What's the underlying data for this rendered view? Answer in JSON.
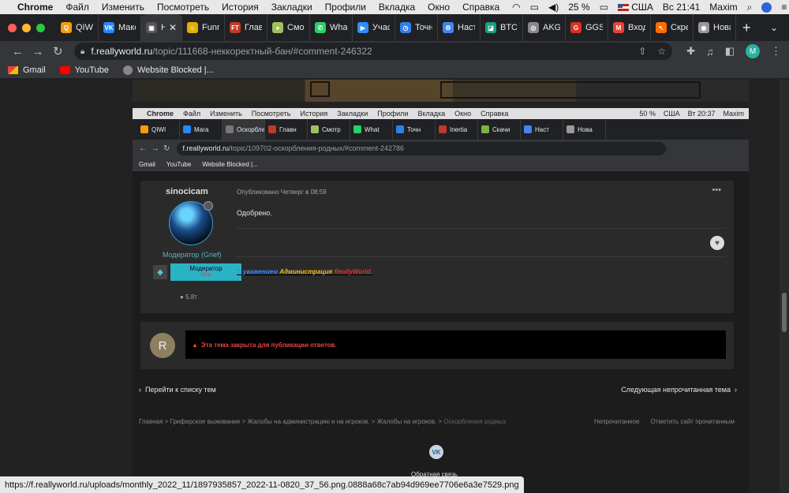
{
  "menubar": {
    "app": "Chrome",
    "items": [
      "Файл",
      "Изменить",
      "Посмотреть",
      "История",
      "Закладки",
      "Профили",
      "Вкладка",
      "Окно",
      "Справка"
    ],
    "battery": "25 %",
    "input": "США",
    "clock": "Вс 21:41",
    "user": "Maxim"
  },
  "tabs": [
    {
      "title": "QIWI",
      "color": "#f39c12",
      "glyph": "Q"
    },
    {
      "title": "Макс",
      "color": "#2787f5",
      "glyph": "VK"
    },
    {
      "title": "Н",
      "color": "#555",
      "glyph": "▣",
      "active": true
    },
    {
      "title": "Funn",
      "color": "#e0b000",
      "glyph": "☺"
    },
    {
      "title": "Глав",
      "color": "#c0392b",
      "glyph": "FT"
    },
    {
      "title": "Смо",
      "color": "#a0c060",
      "glyph": "●"
    },
    {
      "title": "What",
      "color": "#25d366",
      "glyph": "✆"
    },
    {
      "title": "Учас",
      "color": "#2d8cff",
      "glyph": "▶"
    },
    {
      "title": "Точн",
      "color": "#2f80ed",
      "glyph": "◷"
    },
    {
      "title": "Наст",
      "color": "#4285f4",
      "glyph": "⚙"
    },
    {
      "title": "BTC",
      "color": "#16a085",
      "glyph": "◪"
    },
    {
      "title": "AKG",
      "color": "#888",
      "glyph": "◎"
    },
    {
      "title": "GGS",
      "color": "#d93025",
      "glyph": "G"
    },
    {
      "title": "Вход",
      "color": "#ea4335",
      "glyph": "M"
    },
    {
      "title": "Скрє",
      "color": "#ff6d00",
      "glyph": "↖"
    },
    {
      "title": "Нова",
      "color": "#999",
      "glyph": "◉"
    }
  ],
  "toolbar": {
    "url_host": "f.reallyworld.ru",
    "url_path": "/topic/111668-неккоректный-бан/#comment-246322",
    "profile_initial": "M"
  },
  "bookmarks": [
    {
      "label": "Gmail"
    },
    {
      "label": "YouTube"
    },
    {
      "label": "Website Blocked |..."
    }
  ],
  "inner": {
    "menubar": {
      "app": "Chrome",
      "items": [
        "Файл",
        "Изменить",
        "Посмотреть",
        "История",
        "Закладки",
        "Профили",
        "Вкладка",
        "Окно",
        "Справка"
      ],
      "battery": "50 %",
      "input": "США",
      "clock": "Вт 20:37",
      "user": "Maxim"
    },
    "tabs": [
      "QIWI",
      "Мага",
      "Оскорбле",
      "Главн",
      "Смотр",
      "What",
      "Точн",
      "Inertia",
      "Скачи",
      "Наст",
      "Нова"
    ],
    "url_host": "f.reallyworld.ru",
    "url_path": "/topic/109702-оскорбления-родных/#comment-242786",
    "bookmarks": [
      "Gmail",
      "YouTube",
      "Website Blocked |..."
    ],
    "post": {
      "username": "sinocicam",
      "published": "Опубликовано Четверг в 08:59",
      "body": "Одобрено.",
      "role": "Модератор (Grief)",
      "role_badge_title": "Модератор",
      "role_badge_sub": "Grief",
      "reputation": "5.8т",
      "signature_1": "С уважением",
      "signature_2": "Администрация",
      "signature_3": "ReallyWorld."
    },
    "closed": {
      "avatar_letter": "R",
      "message": "Эта тема закрыта для публикации ответов."
    },
    "nav": {
      "prev": "Перейти к списку тем",
      "next": "Следующая непрочитанная тема"
    },
    "breadcrumbs": [
      "Главная",
      "Гриферское выживание",
      "Жалобы на администрацию и на игроков.",
      "Жалобы на игроков.",
      "Оскорбления родных"
    ],
    "crumbs_right": [
      "Непрочитанное",
      "Отметить сайт прочитанным"
    ],
    "feedback": "Обратная связь",
    "vk": "VK"
  },
  "statusbar": "https://f.reallyworld.ru/uploads/monthly_2022_11/1897935857_2022-11-0820_37_56.png.0888a68c7ab94d969ee7706e6a3e7529.png"
}
